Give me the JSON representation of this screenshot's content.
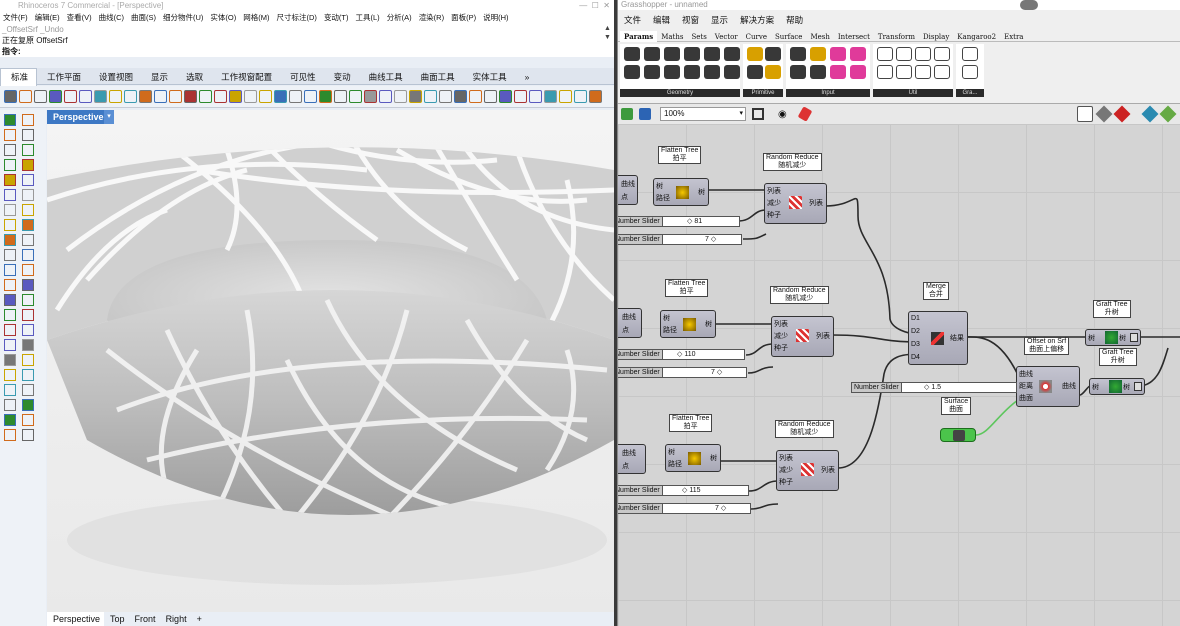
{
  "rhino": {
    "title": "Rhinoceros 7 Commercial - [Perspective]",
    "menu": [
      "文件(F)",
      "编辑(E)",
      "查看(V)",
      "曲线(C)",
      "曲面(S)",
      "细分物件(U)",
      "实体(O)",
      "网格(M)",
      "尺寸标注(D)",
      "变动(T)",
      "工具(L)",
      "分析(A)",
      "渲染(R)",
      "面板(P)",
      "说明(H)"
    ],
    "cmd_history": "_OffsetSrf _Undo",
    "cmd_status": "正在复原 OffsetSrf",
    "cmd_prompt": "指令:",
    "tabs": [
      "标准",
      "工作平面",
      "设置视图",
      "显示",
      "选取",
      "工作视窗配置",
      "可见性",
      "变动",
      "曲线工具",
      "曲面工具",
      "实体工具"
    ],
    "tabs_more": "»",
    "viewport_label": "Perspective",
    "viewport_tabs": [
      "Perspective",
      "Top",
      "Front",
      "Right"
    ],
    "viewport_add": "+"
  },
  "gh": {
    "title": "Grasshopper - unnamed",
    "menu": [
      "文件",
      "编辑",
      "视窗",
      "显示",
      "解决方案",
      "帮助"
    ],
    "tabs": [
      "Params",
      "Maths",
      "Sets",
      "Vector",
      "Curve",
      "Surface",
      "Mesh",
      "Intersect",
      "Transform",
      "Display",
      "Kangaroo2",
      "Extra"
    ],
    "ribbon_groups": [
      "Geometry",
      "Primitive",
      "Input",
      "Util",
      "Gra..."
    ],
    "zoom": "100%",
    "components": {
      "ft1": {
        "title": "Flatten Tree",
        "cn": "拍平",
        "in": [
          "树",
          "路径"
        ],
        "out": "树"
      },
      "ft2": {
        "title": "Flatten Tree",
        "cn": "拍平",
        "in": [
          "树",
          "路径"
        ],
        "out": "树"
      },
      "ft3": {
        "title": "Flatten Tree",
        "cn": "拍平",
        "in": [
          "树",
          "路径"
        ],
        "out": "树"
      },
      "rr1": {
        "title": "Random Reduce",
        "cn": "随机减少",
        "in": [
          "列表",
          "减少",
          "种子"
        ],
        "out": "列表"
      },
      "rr2": {
        "title": "Random Reduce",
        "cn": "随机减少",
        "in": [
          "列表",
          "减少",
          "种子"
        ],
        "out": "列表"
      },
      "rr3": {
        "title": "Random Reduce",
        "cn": "随机减少",
        "in": [
          "列表",
          "减少",
          "种子"
        ],
        "out": "列表"
      },
      "merge": {
        "title": "Merge",
        "cn": "合并",
        "in": [
          "D1",
          "D2",
          "D3",
          "D4"
        ],
        "out": "结果"
      },
      "offset": {
        "title": "Offset on Srf",
        "cn": "曲面上偏移",
        "in": [
          "曲线",
          "距离",
          "曲面"
        ],
        "out": "曲线"
      },
      "graft1": {
        "title": "Graft Tree",
        "cn": "升树",
        "in": "树",
        "out": "树"
      },
      "graft2": {
        "title": "Graft Tree",
        "cn": "升树",
        "in": "树",
        "out": "树"
      },
      "surface": {
        "title": "Surface",
        "cn": "曲面"
      },
      "p1": {
        "a": "曲线",
        "b": "点"
      },
      "p2": {
        "a": "曲线",
        "b": "点"
      },
      "p3": {
        "a": "曲线",
        "b": "点"
      }
    },
    "sliders": {
      "s1": {
        "label": "Number Slider",
        "value": "◇ 81"
      },
      "s2": {
        "label": "Number Slider",
        "value": "7 ◇"
      },
      "s3": {
        "label": "Number Slider",
        "value": "◇ 110"
      },
      "s4": {
        "label": "Number Slider",
        "value": "7 ◇"
      },
      "s5": {
        "label": "Number Slider",
        "value": "◇ 115"
      },
      "s6": {
        "label": "Number Slider",
        "value": "7 ◇"
      },
      "s7": {
        "label": "Number Slider",
        "value": "◇ 1.5"
      }
    }
  }
}
